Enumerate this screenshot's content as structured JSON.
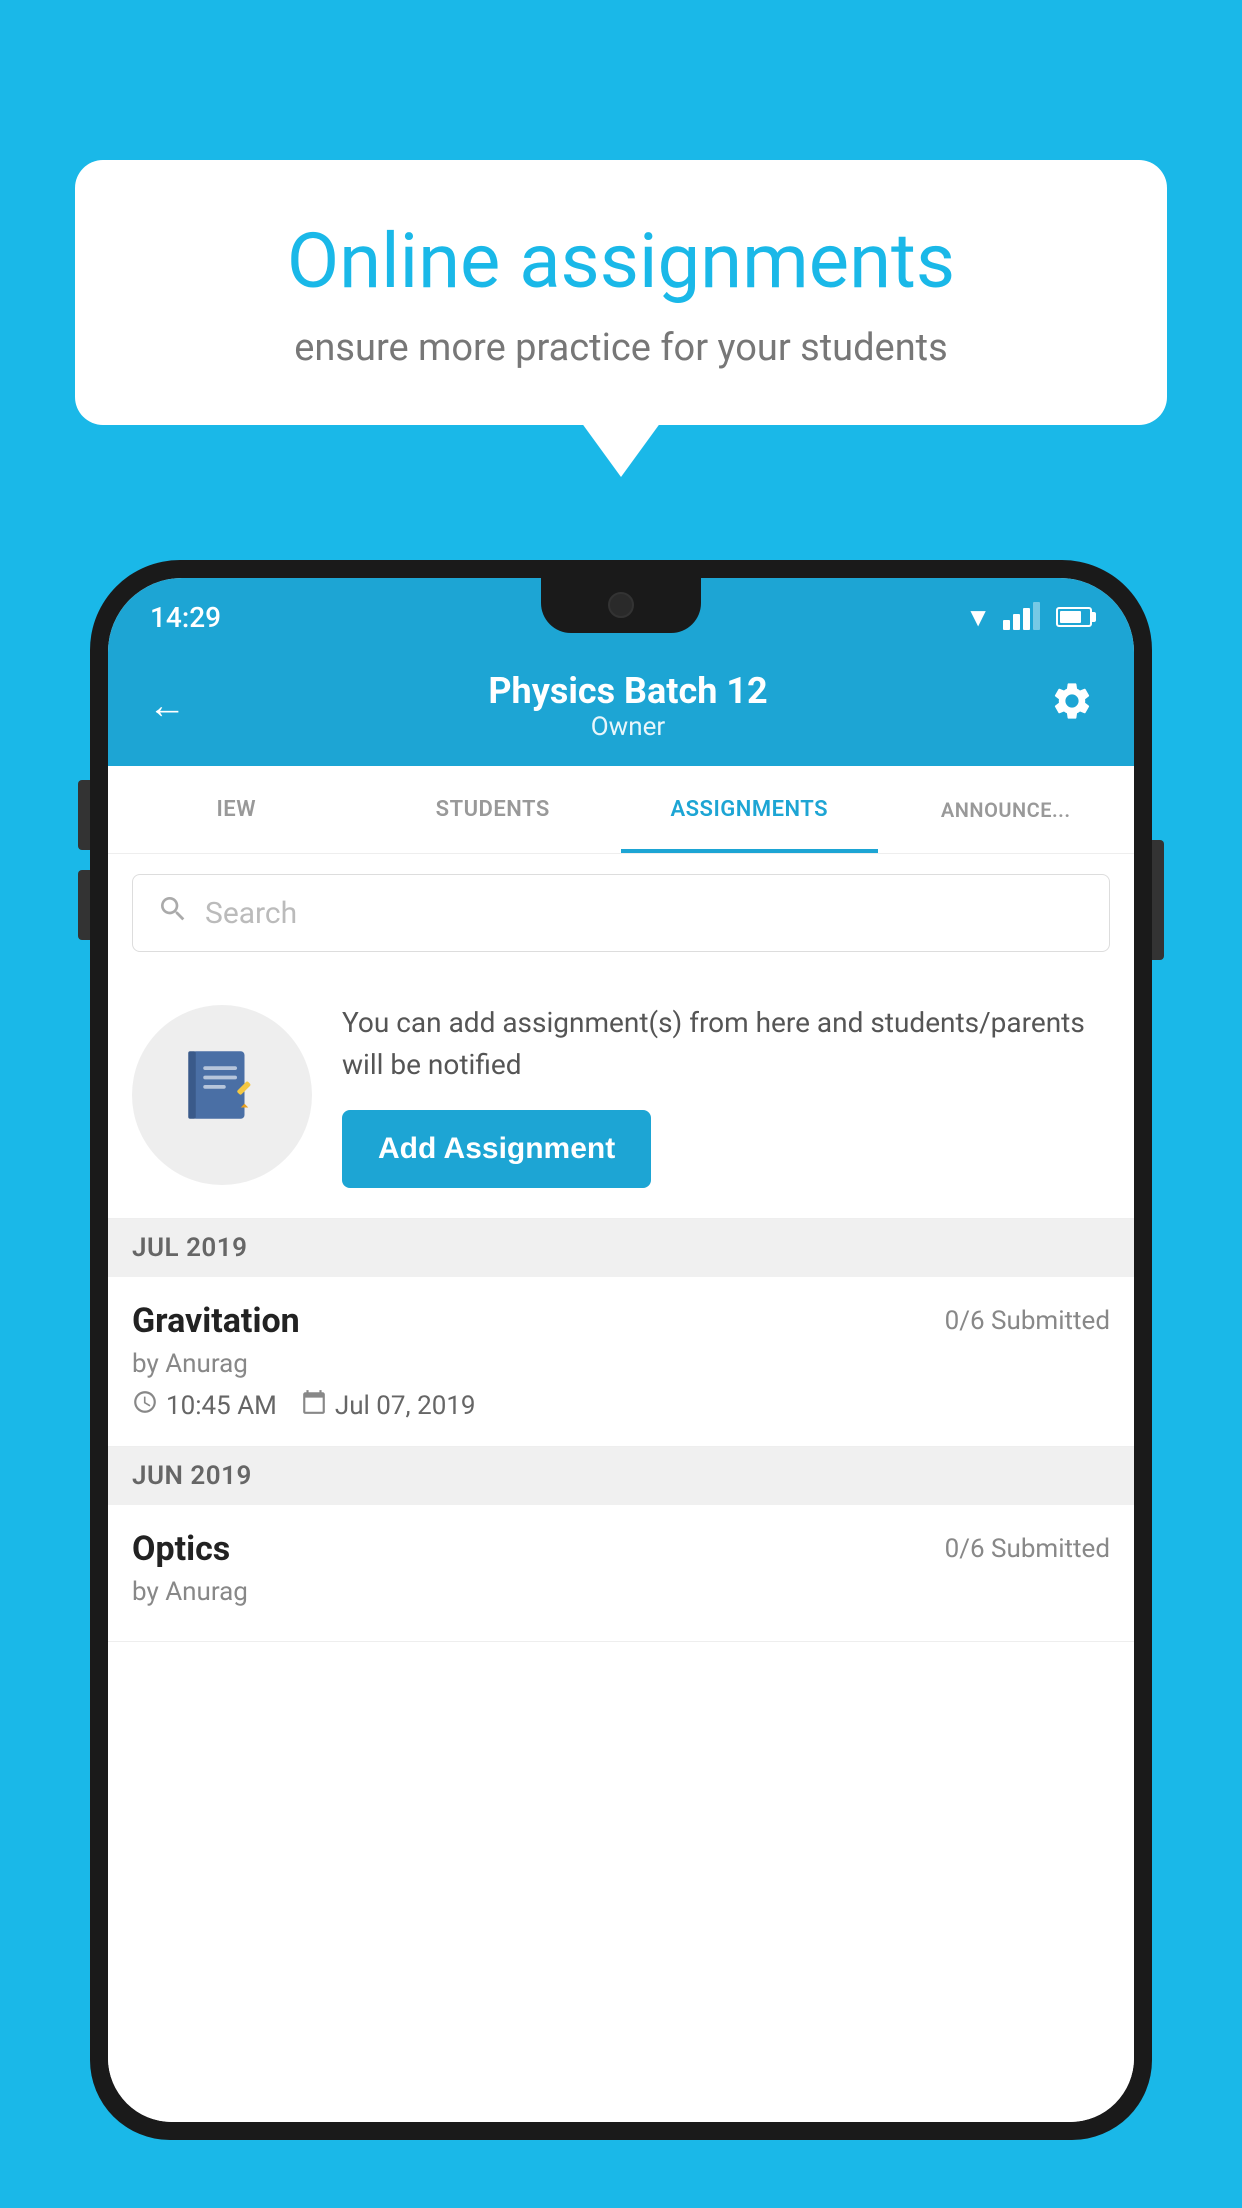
{
  "background_color": "#1ab8e8",
  "speech_bubble": {
    "title": "Online assignments",
    "subtitle": "ensure more practice for your students"
  },
  "status_bar": {
    "time": "14:29"
  },
  "app_bar": {
    "title": "Physics Batch 12",
    "subtitle": "Owner",
    "back_label": "←",
    "settings_label": "⚙"
  },
  "tabs": [
    {
      "label": "IEW",
      "active": false
    },
    {
      "label": "STUDENTS",
      "active": false
    },
    {
      "label": "ASSIGNMENTS",
      "active": true
    },
    {
      "label": "ANNOUNCE...",
      "active": false
    }
  ],
  "search": {
    "placeholder": "Search"
  },
  "add_assignment_section": {
    "info_text": "You can add assignment(s) from here and students/parents will be notified",
    "button_label": "Add Assignment"
  },
  "assignment_groups": [
    {
      "month": "JUL 2019",
      "assignments": [
        {
          "name": "Gravitation",
          "submitted": "0/6 Submitted",
          "by": "by Anurag",
          "time": "10:45 AM",
          "date": "Jul 07, 2019"
        }
      ]
    },
    {
      "month": "JUN 2019",
      "assignments": [
        {
          "name": "Optics",
          "submitted": "0/6 Submitted",
          "by": "by Anurag",
          "time": "",
          "date": ""
        }
      ]
    }
  ]
}
